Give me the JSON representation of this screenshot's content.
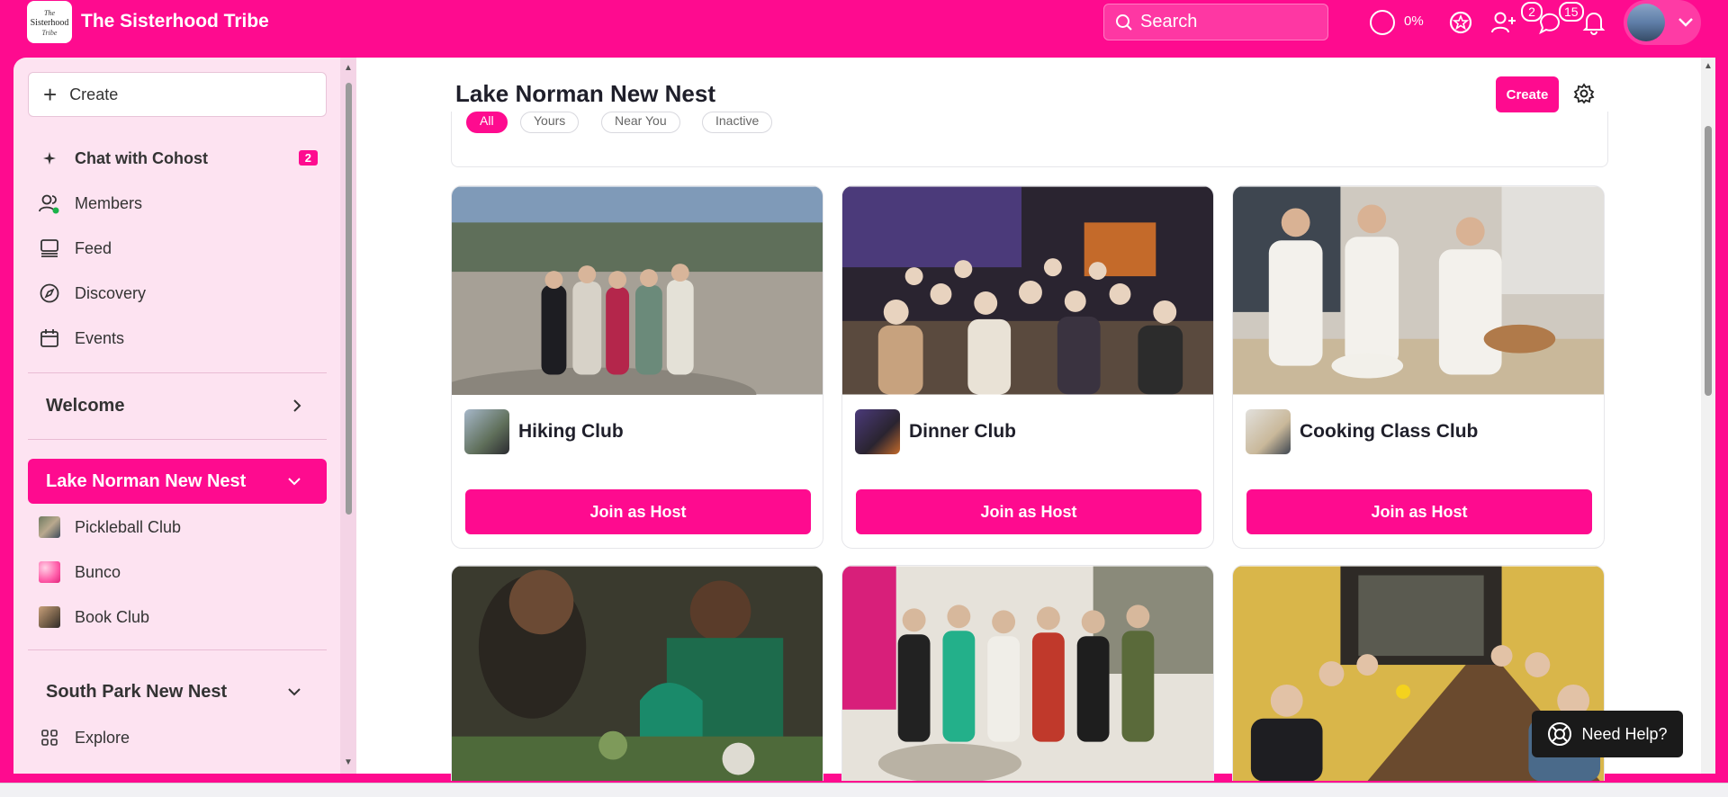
{
  "app": {
    "title": "The Sisterhood Tribe",
    "logo_text": "The Sisterhood Tribe",
    "brand_color": "#fe0b8f"
  },
  "topbar": {
    "search_placeholder": "Search",
    "progress": "0%",
    "friend_requests_count": "2",
    "chats_count": "15",
    "icons": [
      "progress-ring-icon",
      "star-badge-icon",
      "add-user-icon",
      "chat-icon",
      "bell-icon",
      "avatar",
      "chevron-down-icon"
    ]
  },
  "sidebar": {
    "create_label": "Create",
    "nav": [
      {
        "label": "Chat with Cohost",
        "count": "2",
        "icon": "sparkle-icon"
      },
      {
        "label": "Members",
        "icon": "members-icon"
      },
      {
        "label": "Feed",
        "icon": "feed-icon"
      },
      {
        "label": "Discovery",
        "icon": "compass-icon"
      },
      {
        "label": "Events",
        "icon": "calendar-icon"
      }
    ],
    "welcome": "Welcome",
    "active_section": "Lake Norman New Nest",
    "section_items": [
      {
        "label": "Pickleball Club"
      },
      {
        "label": "Bunco"
      },
      {
        "label": "Book Club"
      }
    ],
    "other_section": "South Park New Nest",
    "explore": "Explore"
  },
  "main": {
    "title": "Lake Norman New Nest",
    "create_label": "Create",
    "filters": [
      "All",
      "Yours",
      "Near You",
      "Inactive"
    ],
    "cards": [
      {
        "name": "Hiking Club",
        "button": "Join as Host"
      },
      {
        "name": "Dinner Club",
        "button": "Join as Host"
      },
      {
        "name": "Cooking Class Club",
        "button": "Join as Host"
      }
    ],
    "help_label": "Need Help?"
  }
}
